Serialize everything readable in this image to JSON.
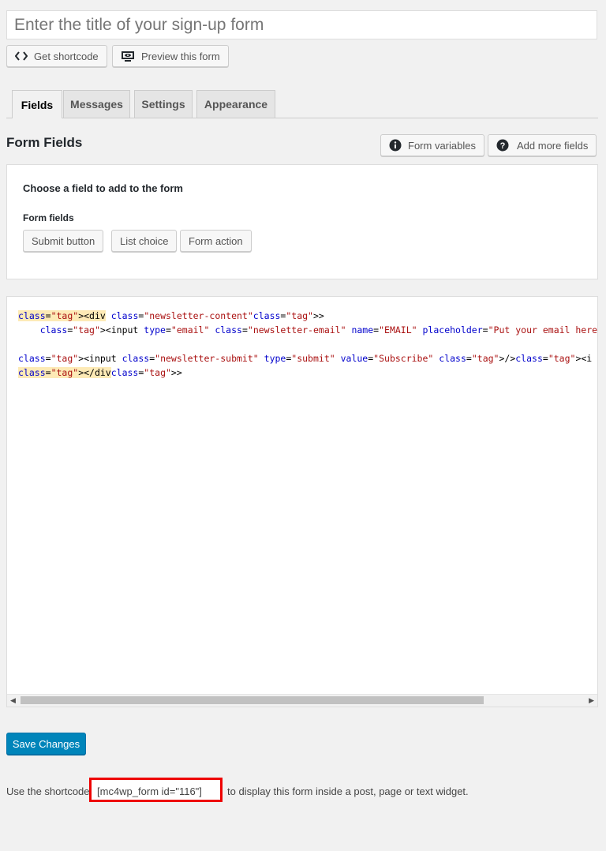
{
  "form": {
    "title_placeholder": "Enter the title of your sign-up form",
    "title_value": ""
  },
  "toolbar": {
    "shortcode_label": "Get shortcode",
    "preview_label": "Preview this form"
  },
  "tabs": [
    {
      "label": "Fields",
      "active": true
    },
    {
      "label": "Messages",
      "active": false
    },
    {
      "label": "Settings",
      "active": false
    },
    {
      "label": "Appearance",
      "active": false
    }
  ],
  "fields_section": {
    "title": "Form Fields",
    "form_variables_label": "Form variables",
    "add_more_fields_label": "Add more fields",
    "panel_heading": "Choose a field to add to the form",
    "panel_subheading": "Form fields",
    "field_buttons": [
      "Submit button",
      "List choice",
      "Form action"
    ]
  },
  "editor": {
    "code_lines": [
      "<div class=\"newsletter-content\">",
      "    <input type=\"email\" class=\"newsletter-email\" name=\"EMAIL\" placeholder=\"Put your email here\" require",
      "",
      "<input class=\"newsletter-submit\" type=\"submit\" value=\"Subscribe\" /><i class=\"fa fa-long-arrow-right\" ar",
      "</div>"
    ],
    "scroll_position": 0.79
  },
  "save": {
    "label": "Save Changes"
  },
  "footer": {
    "prefix": "Use the shortcode",
    "shortcode": "[mc4wp_form id=\"116\"]",
    "suffix": "to display this form inside a post, page or text widget."
  },
  "colors": {
    "primary": "#0085ba",
    "highlight_border": "#ee0000",
    "background": "#f1f1f1"
  },
  "icons": {
    "shortcode": "code-icon",
    "preview": "eye-screen-icon",
    "form_variables": "info-icon",
    "add_more_fields": "help-icon"
  }
}
